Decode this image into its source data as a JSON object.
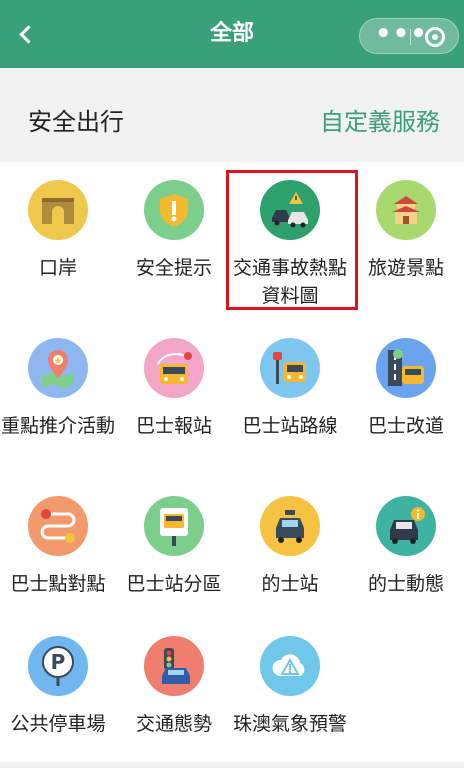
{
  "header": {
    "title": "全部"
  },
  "section": {
    "title": "安全出行",
    "custom_link": "自定義服務"
  },
  "services": [
    {
      "label": "口岸",
      "icon": "port-gate-icon",
      "color": "#efc94c"
    },
    {
      "label": "安全提示",
      "icon": "shield-alert-icon",
      "color": "#7ccf8b"
    },
    {
      "label": "交通事故熱點資料圖",
      "icon": "car-accident-icon",
      "color": "#2ea06e"
    },
    {
      "label": "旅遊景點",
      "icon": "pagoda-icon",
      "color": "#a8d86e"
    },
    {
      "label": "重點推介活動",
      "icon": "map-star-icon",
      "color": "#8fb7ef"
    },
    {
      "label": "巴士報站",
      "icon": "bus-route-icon",
      "color": "#f3a6c8"
    },
    {
      "label": "巴士站路線",
      "icon": "bus-stop-icon",
      "color": "#7fc6ef"
    },
    {
      "label": "巴士改道",
      "icon": "bus-detour-icon",
      "color": "#6aa4ee"
    },
    {
      "label": "巴士點對點",
      "icon": "route-points-icon",
      "color": "#f39a6d"
    },
    {
      "label": "巴士站分區",
      "icon": "bus-stop-sign-icon",
      "color": "#7ccf8b"
    },
    {
      "label": "的士站",
      "icon": "taxi-icon",
      "color": "#f5c242"
    },
    {
      "label": "的士動態",
      "icon": "taxi-info-icon",
      "color": "#3fb3a2"
    },
    {
      "label": "公共停車場",
      "icon": "parking-icon",
      "color": "#72b6ef"
    },
    {
      "label": "交通態勢",
      "icon": "traffic-light-car-icon",
      "color": "#f07e6e"
    },
    {
      "label": "珠澳氣象預警",
      "icon": "weather-warning-icon",
      "color": "#6fc7ea"
    }
  ]
}
